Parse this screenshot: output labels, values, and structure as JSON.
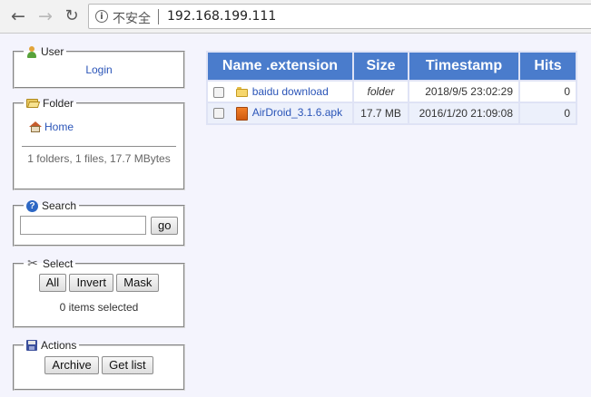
{
  "browser": {
    "security_label": "不安全",
    "url": "192.168.199.111"
  },
  "panels": {
    "user": {
      "legend": "User",
      "login_link": "Login"
    },
    "folder": {
      "legend": "Folder",
      "home_link": "Home",
      "stats": "1 folders, 1 files, 17.7 MBytes"
    },
    "search": {
      "legend": "Search",
      "input_value": "",
      "go_label": "go"
    },
    "select": {
      "legend": "Select",
      "all_label": "All",
      "invert_label": "Invert",
      "mask_label": "Mask",
      "status": "0 items selected"
    },
    "actions": {
      "legend": "Actions",
      "archive_label": "Archive",
      "getlist_label": "Get list"
    }
  },
  "table": {
    "headers": [
      "Name .extension",
      "Size",
      "Timestamp",
      "Hits"
    ],
    "rows": [
      {
        "name": "baidu download",
        "size": "folder",
        "timestamp": "2018/9/5 23:02:29",
        "hits": "0",
        "type": "folder"
      },
      {
        "name": "AirDroid_3.1.6.apk",
        "size": "17.7 MB",
        "timestamp": "2016/1/20 21:09:08",
        "hits": "0",
        "type": "apk"
      }
    ]
  },
  "colors": {
    "header_bg": "#4a7ccc",
    "link": "#2b55b8",
    "page_bg": "#f4f4fd"
  }
}
